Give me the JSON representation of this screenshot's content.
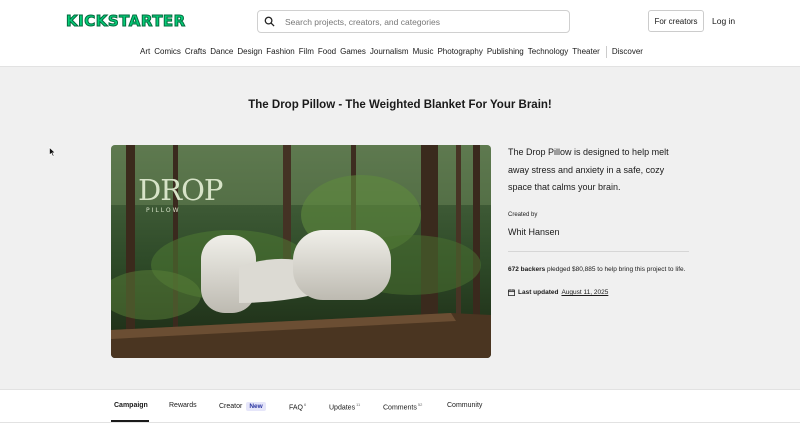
{
  "header": {
    "logo": "KICKSTARTER",
    "search_placeholder": "Search projects, creators, and categories",
    "for_creators": "For creators",
    "login": "Log in"
  },
  "categories": [
    "Art",
    "Comics",
    "Crafts",
    "Dance",
    "Design",
    "Fashion",
    "Film",
    "Food",
    "Games",
    "Journalism",
    "Music",
    "Photography",
    "Publishing",
    "Technology",
    "Theater"
  ],
  "discover": "Discover",
  "project": {
    "title": "The Drop Pillow - The Weighted Blanket For Your Brain!",
    "hero_logo": "DROP",
    "hero_sub": "PILLOW",
    "description": "The Drop Pillow is designed to help melt away stress and anxiety in a safe, cozy space that calms your brain.",
    "created_by_label": "Created by",
    "creator": "Whit Hansen",
    "backers": "672 backers",
    "pledged_text": "pledged $80,885 to help bring this project to life.",
    "last_updated_label": "Last updated",
    "last_updated_date": "August 11, 2025"
  },
  "tabs": {
    "campaign": "Campaign",
    "rewards": "Rewards",
    "creator": "Creator",
    "creator_badge": "New",
    "faq": "FAQ",
    "faq_count": "6",
    "updates": "Updates",
    "updates_count": "11",
    "comments": "Comments",
    "comments_count": "52",
    "community": "Community"
  },
  "colors": {
    "brand": "#05ce78",
    "badge_bg": "#e6e6fa",
    "badge_text": "#2a35a0"
  }
}
